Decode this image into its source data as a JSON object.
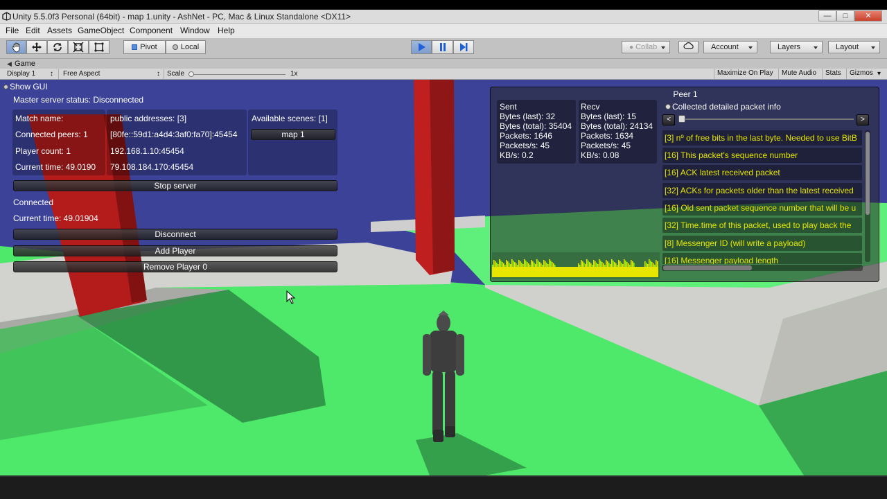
{
  "window": {
    "title": "Unity 5.5.0f3 Personal (64bit) - map 1.unity - AshNet - PC, Mac & Linux Standalone <DX11>",
    "controls": [
      "minimize",
      "maximize",
      "close"
    ]
  },
  "menu": {
    "items": [
      "File",
      "Edit",
      "Assets",
      "GameObject",
      "Component",
      "Window",
      "Help"
    ]
  },
  "toolbar": {
    "tools": [
      "hand-tool",
      "move-tool",
      "rotate-tool",
      "scale-tool",
      "rect-tool"
    ],
    "pivot_label": "Pivot",
    "local_label": "Local",
    "play_state": "playing",
    "collab_label": "Collab",
    "account_label": "Account",
    "layers_label": "Layers",
    "layout_label": "Layout"
  },
  "game_view": {
    "tab_label": "Game",
    "display_label": "Display 1",
    "aspect_label": "Free Aspect",
    "scale_label": "Scale",
    "scale_value": "1x",
    "maximize_label": "Maximize On Play",
    "mute_label": "Mute Audio",
    "stats_label": "Stats",
    "gizmos_label": "Gizmos"
  },
  "gui": {
    "show_gui_label": "Show GUI",
    "master_status": "Master server status: Disconnected",
    "match_name_label": "Match name:",
    "connected_peers": "Connected peers: 1",
    "player_count": "Player count: 1",
    "current_time_1": "Current time: 49.0190",
    "public_addresses": "public addresses: [3]",
    "addresses": [
      "[80fe::59d1:a4d4:3af0:fa70]:45454",
      "192.168.1.10:45454",
      "79.108.184.170:45454"
    ],
    "available_scenes": "Available scenes: [1]",
    "scene_button": "map 1",
    "stop_server": "Stop server",
    "connected_label": "Connected",
    "current_time_2": "Current time: 49.01904",
    "disconnect": "Disconnect",
    "add_player": "Add Player",
    "remove_player": "Remove Player 0"
  },
  "peer": {
    "title": "Peer 1",
    "sent": [
      "Sent",
      "Bytes (last): 32",
      "Bytes (total): 35404",
      "Packets: 1646",
      "Packets/s: 45",
      "KB/s: 0.2"
    ],
    "recv": [
      "Recv",
      "Bytes (last): 15",
      "Bytes (total): 24134",
      "Packets: 1634",
      "Packets/s: 45",
      "KB/s: 0.08"
    ],
    "detail_toggle_label": "Collected detailed packet info",
    "prev_label": "<",
    "next_label": ">",
    "packet_rows": [
      "[3] nº of free bits in the last byte. Needed to use BitB",
      "[16] This packet's sequence number",
      "[16] ACK latest received packet",
      "[32] ACKs for packets older than the latest received",
      "[16] Old sent packet sequence number that will be u",
      "[32] Time.time of this packet, used to play back the",
      "[8] Messenger ID (will write a payload)",
      "[16] Messenger payload length"
    ],
    "colors": {
      "packet_text": "#e6e600",
      "graph_fill": "#e6e600",
      "graph_highlight": "#7fff00"
    }
  },
  "scene_colors": {
    "sky": "#3a4194",
    "ground": "#4de86a",
    "platform": "#c9c9c9",
    "pillar": "#b51d1d"
  }
}
